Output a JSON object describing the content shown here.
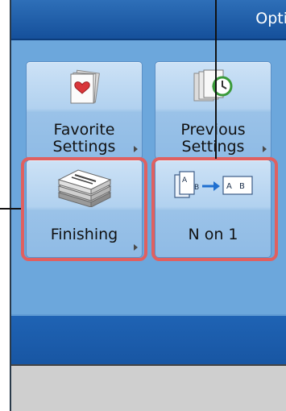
{
  "header": {
    "title": "Opti"
  },
  "tiles": [
    {
      "label_line1": "Favorite",
      "label_line2": "Settings",
      "icon": "favorite-heart-icon"
    },
    {
      "label_line1": "Previous",
      "label_line2": "Settings",
      "icon": "previous-settings-clock-icon"
    },
    {
      "label": "Finishing",
      "icon": "finishing-stack-icon"
    },
    {
      "label": "N on 1",
      "icon": "n-on-1-icon"
    }
  ],
  "n_on_1_icon_letters": [
    "A",
    "B"
  ],
  "colors": {
    "title_bar": "#15509b",
    "panel": "#6ca7dc",
    "highlight": "#e06060",
    "bottom_bar": "#1856a3"
  }
}
